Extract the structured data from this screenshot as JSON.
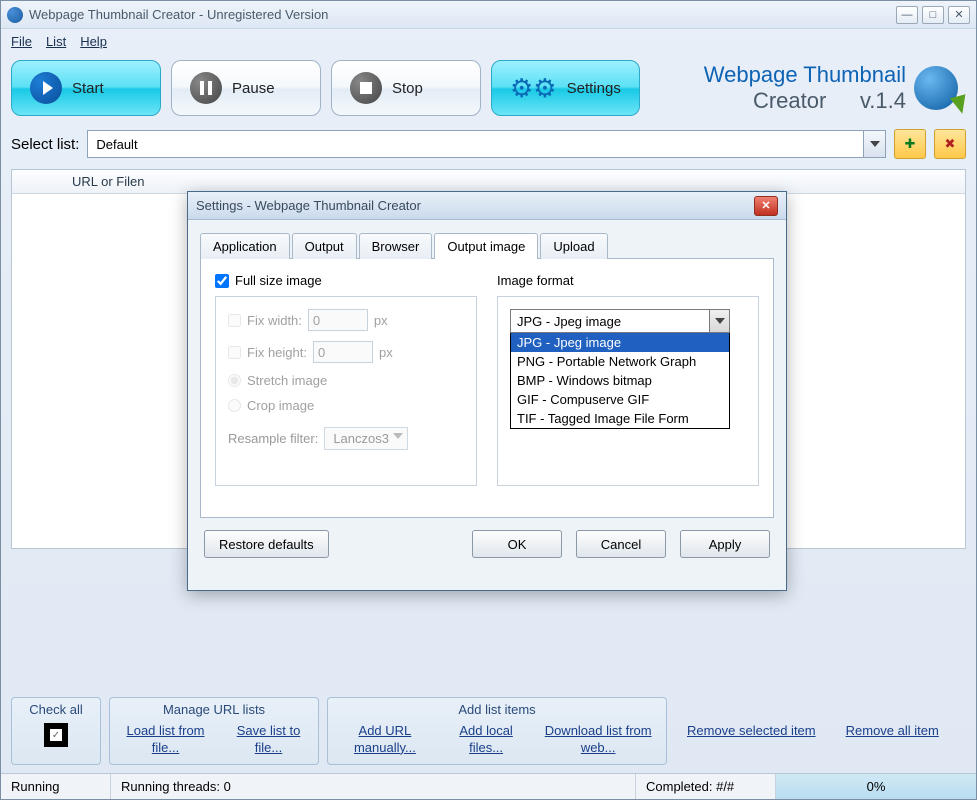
{
  "window": {
    "title": "Webpage Thumbnail Creator - Unregistered Version"
  },
  "menu": {
    "file": "File",
    "list": "List",
    "help": "Help"
  },
  "toolbar": {
    "start": "Start",
    "pause": "Pause",
    "stop": "Stop",
    "settings": "Settings"
  },
  "brand": {
    "line1": "Webpage Thumbnail",
    "line2": "Creator",
    "version": "v.1.4"
  },
  "selectlist": {
    "label": "Select list:",
    "value": "Default"
  },
  "list_header": "URL or Filen",
  "bottom": {
    "checkall": "Check all",
    "manage": {
      "title": "Manage URL lists",
      "load": "Load list from file...",
      "save": "Save list to file..."
    },
    "add": {
      "title": "Add list items",
      "manual": "Add URL manually...",
      "local": "Add local files...",
      "web": "Download list from web..."
    },
    "remove_sel": "Remove selected item",
    "remove_all": "Remove all item"
  },
  "status": {
    "running": "Running",
    "threads": "Running threads: 0",
    "completed": "Completed: #/#",
    "progress": "0%"
  },
  "dialog": {
    "title": "Settings - Webpage Thumbnail Creator",
    "tabs": [
      "Application",
      "Output",
      "Browser",
      "Output image",
      "Upload"
    ],
    "active_tab": "Output image",
    "full_size": "Full size image",
    "fix_width_label": "Fix width:",
    "fix_width_value": "0",
    "fix_height_label": "Fix height:",
    "fix_height_value": "0",
    "px": "px",
    "stretch": "Stretch image",
    "crop": "Crop image",
    "resample_label": "Resample filter:",
    "resample_value": "Lanczos3",
    "image_format_label": "Image format",
    "format_selected": "JPG - Jpeg image",
    "format_options": [
      "JPG - Jpeg image",
      "PNG - Portable Network Graph",
      "BMP - Windows bitmap",
      "GIF - Compuserve GIF",
      "TIF - Tagged Image File Form"
    ],
    "buttons": {
      "restore": "Restore defaults",
      "ok": "OK",
      "cancel": "Cancel",
      "apply": "Apply"
    }
  }
}
